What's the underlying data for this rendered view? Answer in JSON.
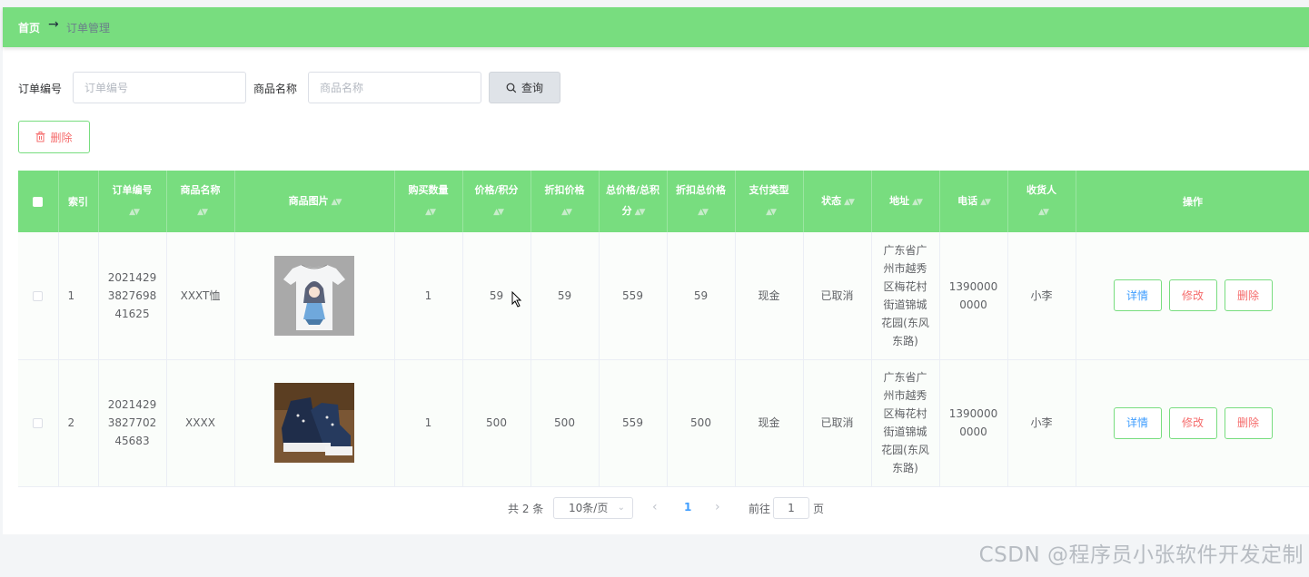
{
  "breadcrumb": {
    "home": "首页",
    "arrow": "→",
    "current": "订单管理"
  },
  "search": {
    "order_no_label": "订单编号",
    "order_no_placeholder": "订单编号",
    "product_name_label": "商品名称",
    "product_name_placeholder": "商品名称",
    "query_label": "查询"
  },
  "toolbar": {
    "delete_label": "删除"
  },
  "table": {
    "headers": [
      "索引",
      "订单编号",
      "商品名称",
      "商品图片",
      "购买数量",
      "价格/积分",
      "折扣价格",
      "总价格/总积分",
      "折扣总价格",
      "支付类型",
      "状态",
      "地址",
      "电话",
      "收货人",
      "操作"
    ],
    "rows": [
      {
        "index": "1",
        "order_no": "202142938276984 1625",
        "order_no_lines": [
          "2021429",
          "3827698",
          "41625"
        ],
        "product": "XXXT恤",
        "qty": "1",
        "price": "59",
        "discount_price": "59",
        "total": "559",
        "discount_total": "59",
        "pay_type": "现金",
        "status": "已取消",
        "address_lines": [
          "广东省广",
          "州市越秀",
          "区梅花村",
          "街道锦城",
          "花园(东风",
          "东路)"
        ],
        "phone_lines": [
          "1390000",
          "0000"
        ],
        "receiver": "小李",
        "image": "tshirt-icon"
      },
      {
        "index": "2",
        "order_no_lines": [
          "2021429",
          "3827702",
          "45683"
        ],
        "product": "XXXX",
        "qty": "1",
        "price": "500",
        "discount_price": "500",
        "total": "559",
        "discount_total": "500",
        "pay_type": "现金",
        "status": "已取消",
        "address_lines": [
          "广东省广",
          "州市越秀",
          "区梅花村",
          "街道锦城",
          "花园(东风",
          "东路)"
        ],
        "phone_lines": [
          "1390000",
          "0000"
        ],
        "receiver": "小李",
        "image": "sneaker-icon"
      }
    ],
    "actions": {
      "detail": "详情",
      "edit": "修改",
      "delete": "删除"
    }
  },
  "pagination": {
    "total": "共 2 条",
    "page_size": "10条/页",
    "current_page": "1",
    "goto_label": "前往",
    "goto_value": "1",
    "page_suffix": "页"
  },
  "watermark": "CSDN @程序员小张软件开发定制",
  "colors": {
    "theme_green": "#78dd7f",
    "danger": "#f56c6c",
    "primary": "#409eff"
  }
}
